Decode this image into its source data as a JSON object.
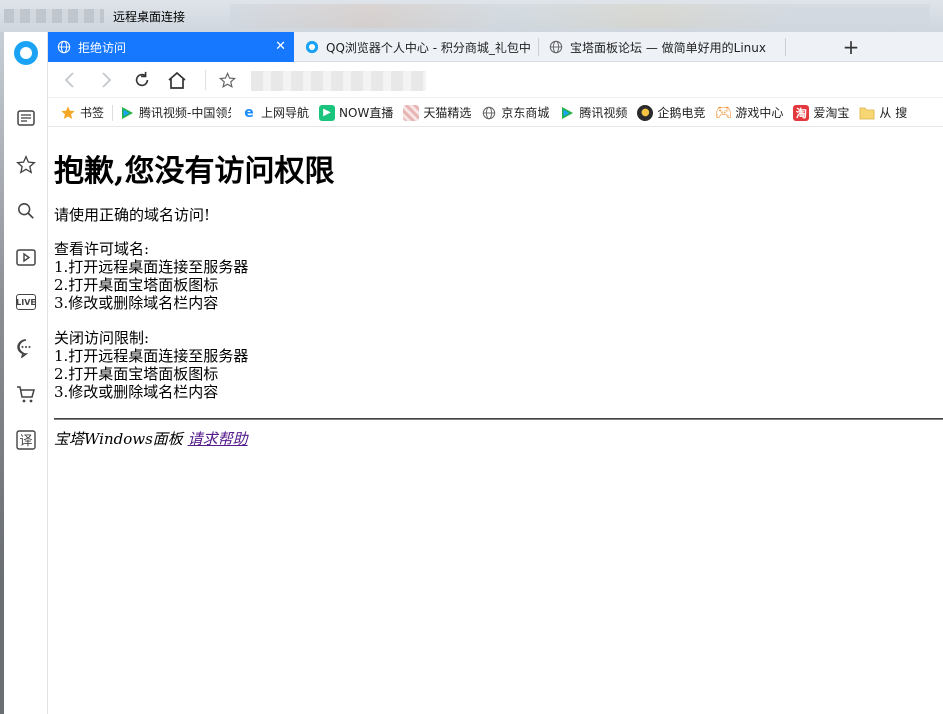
{
  "window": {
    "title": "远程桌面连接"
  },
  "tabs": [
    {
      "label": "拒绝访问",
      "icon": "globe-icon",
      "active": true
    },
    {
      "label": "QQ浏览器个人中心 - 积分商城_礼包中",
      "icon": "qq-browser-icon",
      "active": false
    },
    {
      "label": "宝塔面板论坛 — 做简单好用的Linux",
      "icon": "globe-icon",
      "active": false
    }
  ],
  "new_tab_label": "+",
  "bookmarks": [
    {
      "label": "书签",
      "icon": "star-icon"
    },
    {
      "label": "腾讯视频-中国领先",
      "icon": "tencent-video-icon"
    },
    {
      "label": "上网导航",
      "icon": "ie-icon"
    },
    {
      "label": "NOW直播",
      "icon": "now-icon"
    },
    {
      "label": "天猫精选",
      "icon": "tmall-icon"
    },
    {
      "label": "京东商城",
      "icon": "globe-icon"
    },
    {
      "label": "腾讯视频",
      "icon": "tencent-video-icon"
    },
    {
      "label": "企鹅电竞",
      "icon": "penguin-icon"
    },
    {
      "label": "游戏中心",
      "icon": "gamepad-icon"
    },
    {
      "label": "爱淘宝",
      "icon": "taobao-icon"
    },
    {
      "label": "从 搜",
      "icon": "folder-icon"
    }
  ],
  "page": {
    "heading": "抱歉,您没有访问权限",
    "message": "请使用正确的域名访问!",
    "view_domains": {
      "title": "查看许可域名:",
      "steps": [
        "1.打开远程桌面连接至服务器",
        "2.打开桌面宝塔面板图标",
        "3.修改或删除域名栏内容"
      ]
    },
    "disable_restriction": {
      "title": "关闭访问限制:",
      "steps": [
        "1.打开远程桌面连接至服务器",
        "2.打开桌面宝塔面板图标",
        "3.修改或删除域名栏内容"
      ]
    },
    "footer_text": "宝塔Windows面板",
    "footer_link": "请求帮助"
  },
  "colors": {
    "active_tab": "#1677ff",
    "link_visited": "#551a8b"
  }
}
